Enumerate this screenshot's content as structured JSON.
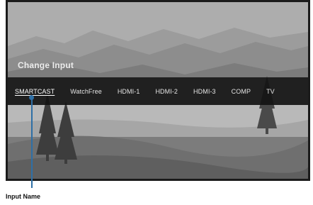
{
  "screen": {
    "title": "Change Input"
  },
  "inputs": [
    {
      "label": "SMARTCAST",
      "selected": true
    },
    {
      "label": "WatchFree",
      "selected": false
    },
    {
      "label": "HDMI-1",
      "selected": false
    },
    {
      "label": "HDMI-2",
      "selected": false
    },
    {
      "label": "HDMI-3",
      "selected": false
    },
    {
      "label": "COMP",
      "selected": false
    },
    {
      "label": "TV",
      "selected": false
    }
  ],
  "callout": {
    "label": "Input Name",
    "color": "#2e6fa6"
  },
  "colors": {
    "menu_bar": "#0c0c0c",
    "frame": "#1b1b1b"
  }
}
